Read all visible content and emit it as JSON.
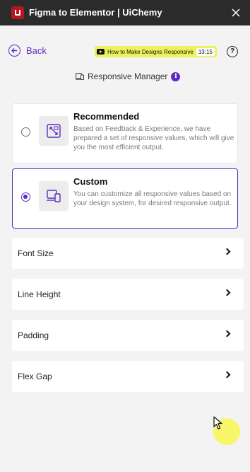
{
  "window": {
    "title": "Figma to Elementor | UiChemy",
    "close_icon": "close-icon"
  },
  "nav": {
    "back_label": "Back",
    "video": {
      "title": "How to Make Designs Responsive",
      "duration": "13:15"
    },
    "help_symbol": "?"
  },
  "section": {
    "title": "Responsive Manager",
    "info_symbol": "i"
  },
  "options": [
    {
      "title": "Recommended",
      "description": "Based on Feedback & Experience, we have prepared a set of responsive values, which will give you the most efficient output.",
      "selected": false,
      "icon": "scale-icon"
    },
    {
      "title": "Custom",
      "description": "You can customize all responsive values based on your design system, for desired responsive output.",
      "selected": true,
      "icon": "devices-icon"
    }
  ],
  "settings": [
    {
      "label": "Font Size"
    },
    {
      "label": "Line Height"
    },
    {
      "label": "Padding"
    },
    {
      "label": "Flex Gap"
    }
  ],
  "colors": {
    "accent": "#5b2bc4",
    "titlebar": "#2b2b2b",
    "video_chip": "#ecf35a",
    "background": "#f3f3f3"
  }
}
